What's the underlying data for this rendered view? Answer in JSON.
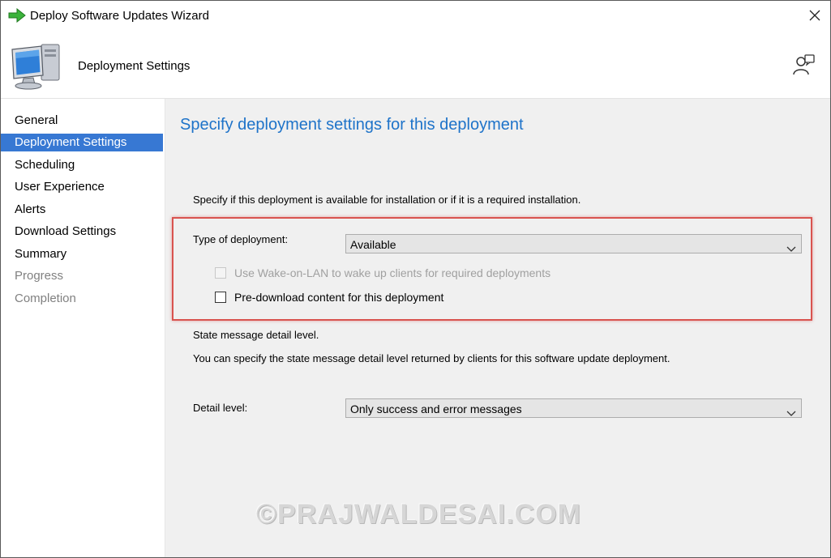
{
  "window": {
    "title": "Deploy Software Updates Wizard"
  },
  "header": {
    "title": "Deployment Settings"
  },
  "sidebar": {
    "items": [
      {
        "label": "General",
        "state": "normal"
      },
      {
        "label": "Deployment Settings",
        "state": "active"
      },
      {
        "label": "Scheduling",
        "state": "normal"
      },
      {
        "label": "User Experience",
        "state": "normal"
      },
      {
        "label": "Alerts",
        "state": "normal"
      },
      {
        "label": "Download Settings",
        "state": "normal"
      },
      {
        "label": "Summary",
        "state": "normal"
      },
      {
        "label": "Progress",
        "state": "disabled"
      },
      {
        "label": "Completion",
        "state": "disabled"
      }
    ]
  },
  "main": {
    "heading": "Specify deployment settings for this deployment",
    "intro": "Specify if this deployment is available for installation or if it is a required installation.",
    "type_of_deployment": {
      "label": "Type of deployment:",
      "value": "Available"
    },
    "wake_on_lan": {
      "label": "Use Wake-on-LAN to wake up clients for required deployments",
      "checked": false,
      "enabled": false
    },
    "pre_download": {
      "label": "Pre-download content for this deployment",
      "checked": false,
      "enabled": true
    },
    "state_message_heading": "State message detail level.",
    "state_message_desc": "You can specify the state message detail level returned by clients for this software update deployment.",
    "detail_level": {
      "label": "Detail level:",
      "value": "Only success and error messages"
    },
    "watermark": "©PRAJWALDESAI.COM"
  },
  "colors": {
    "accent": "#3778d3",
    "heading": "#1e73c9",
    "highlight": "#d9534f",
    "panel_bg": "#f0f0f0"
  },
  "icons": {
    "title": "green-arrow-icon",
    "header": "computer-monitor-icon",
    "help": "user-help-icon",
    "close": "close-icon",
    "dropdown": "chevron-down-icon"
  }
}
